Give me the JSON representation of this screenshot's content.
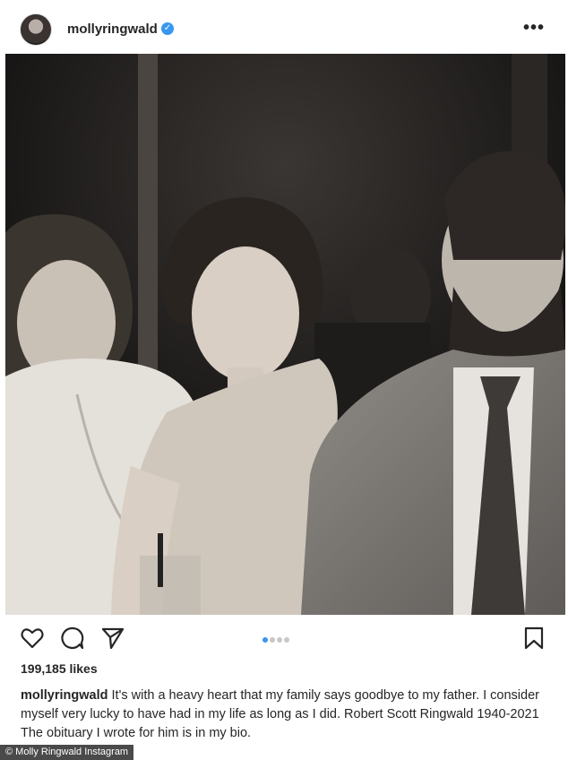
{
  "post": {
    "username": "mollyringwald",
    "verified": true,
    "likes": "199,185 likes",
    "caption_text": "It's with a heavy heart that my family says goodbye to my father. I consider myself very lucky to have had in my life as long as I did. Robert Scott Ringwald 1940-2021 The obituary I wrote for him is in my bio.",
    "carousel_total": 4,
    "carousel_active": 1
  },
  "credit": "© Molly Ringwald Instagram",
  "colors": {
    "accent": "#3897f0",
    "text": "#262626"
  },
  "icons": [
    "avatar",
    "verified-badge-icon",
    "more-options-icon",
    "heart-icon",
    "comment-icon",
    "share-icon",
    "bookmark-icon"
  ]
}
